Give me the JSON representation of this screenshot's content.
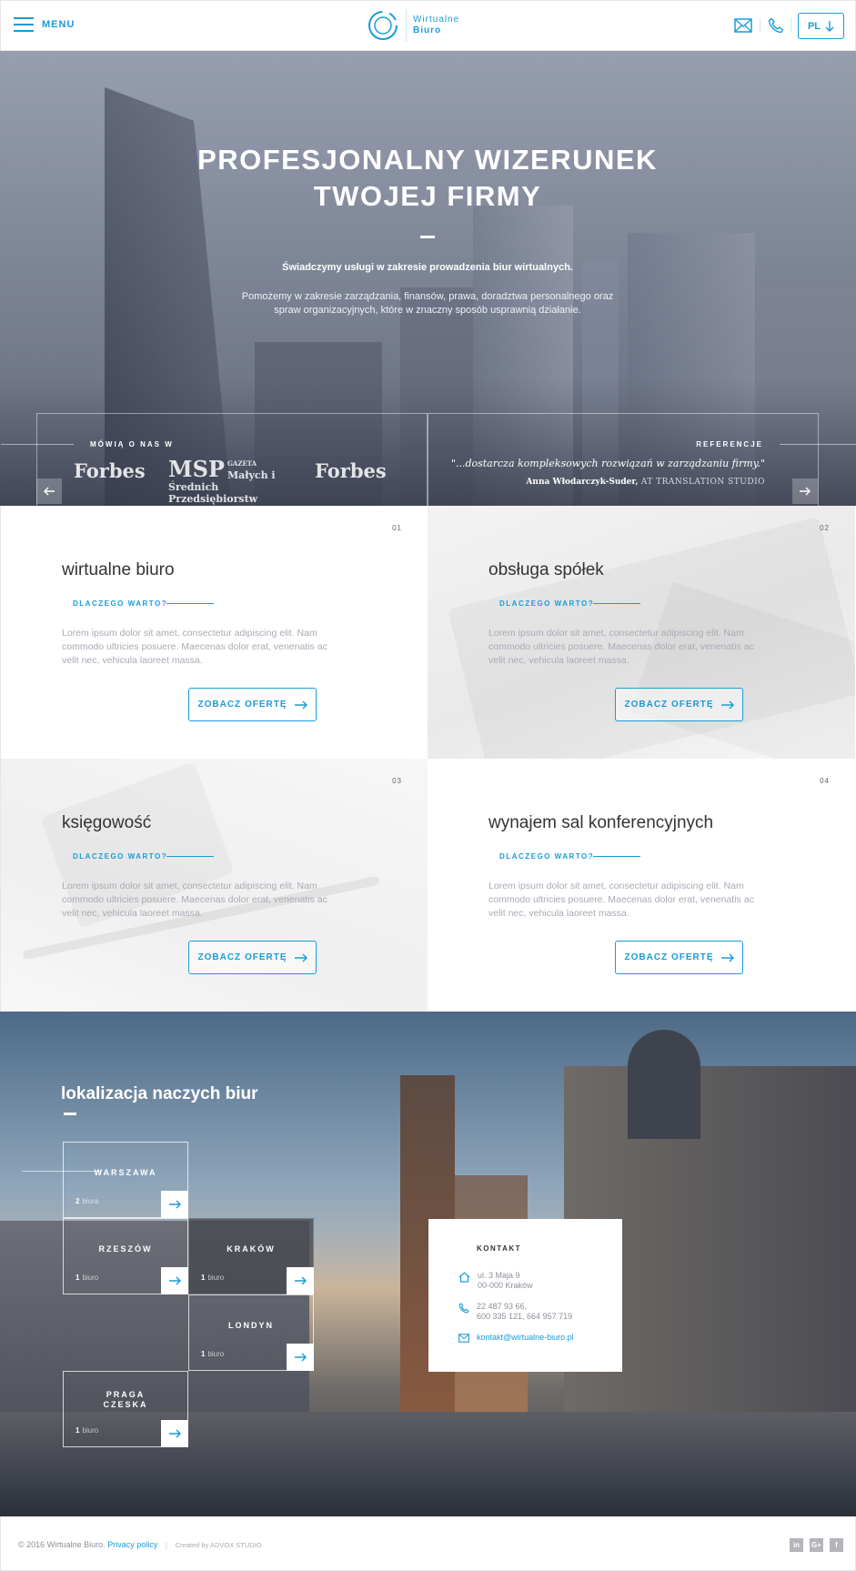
{
  "header": {
    "menu_label": "MENU",
    "logo_line1": "Wirtualne",
    "logo_line2": "Biuro",
    "lang_label": "PL"
  },
  "hero": {
    "title_line1": "PROFESJONALNY WIZERUNEK",
    "title_line2": "TWOJEJ FIRMY",
    "subtitle": "Świadczymy usługi w zakresie prowadzenia biur wirtualnych.",
    "desc_line1": "Pomożemy w zakresie zarządzania, finansów, prawa, doradztwa personalnego oraz",
    "desc_line2": "spraw organizacyjnych, które w znaczny sposób usprawnią działanie.",
    "press_label": "MÓWIĄ O NAS W",
    "press": [
      "Forbes",
      "MSP",
      "GAZETA",
      "Małych i Średnich",
      "Przedsiębiorstw",
      "Forbes"
    ],
    "ref_label": "REFERENCJE",
    "quote": "\"...dostarcza kompleksowych rozwiązań w zarządzaniu firmy.\"",
    "quote_author": "Anna Włodarczyk-Suder,",
    "quote_company": "AT TRANSLATION STUDIO"
  },
  "services": [
    {
      "num": "01",
      "title": "wirtualne biuro",
      "why": "DLACZEGO WARTO?",
      "text": "Lorem ipsum dolor sit amet, consectetur adipiscing elit. Nam commodo ultricies posuere. Maecenas dolor erat, venenatis ac velit nec, vehicula laoreet massa.",
      "button": "ZOBACZ OFERTĘ"
    },
    {
      "num": "02",
      "title": "obsługa spółek",
      "why": "DLACZEGO WARTO?",
      "text": "Lorem ipsum dolor sit amet, consectetur adipiscing elit. Nam commodo ultricies posuere. Maecenas dolor erat, venenatis ac velit nec, vehicula laoreet massa.",
      "button": "ZOBACZ OFERTĘ"
    },
    {
      "num": "03",
      "title": "księgowość",
      "why": "DLACZEGO WARTO?",
      "text": "Lorem ipsum dolor sit amet, consectetur adipiscing elit. Nam commodo ultricies posuere. Maecenas dolor erat, venenatis ac velit nec, vehicula laoreet massa.",
      "button": "ZOBACZ OFERTĘ"
    },
    {
      "num": "04",
      "title": "wynajem sal konferencyjnych",
      "why": "DLACZEGO WARTO?",
      "text": "Lorem ipsum dolor sit amet, consectetur adipiscing elit. Nam commodo ultricies posuere. Maecenas dolor erat, venenatis ac velit nec, vehicula laoreet massa.",
      "button": "ZOBACZ OFERTĘ"
    }
  ],
  "locations": {
    "title": "lokalizacja naczych biur",
    "cities": [
      {
        "name": "WARSZAWA",
        "count": "2",
        "unit": "biura"
      },
      {
        "name": "RZESZÓW",
        "count": "1",
        "unit": "biuro"
      },
      {
        "name": "KRAKÓW",
        "count": "1",
        "unit": "biuro"
      },
      {
        "name": "LONDYN",
        "count": "1",
        "unit": "biuro"
      },
      {
        "name": "PRAGA CZESKA",
        "count": "1",
        "unit": "biuro"
      }
    ],
    "contact": {
      "title": "KONTAKT",
      "address1": "ul. 3 Maja 9",
      "address2": "00-000 Kraków",
      "phone1": "22 487 93 66,",
      "phone2": "600 335 121, 664 957 719",
      "email": "kontakt@wirtualne-biuro.pl"
    }
  },
  "footer": {
    "copyright": "© 2016 Wirtualne Biuro.",
    "privacy": "Privacy policy",
    "separator": "|",
    "credit": "Created by ADVOX STUDIO",
    "social": [
      "in",
      "G+",
      "f"
    ]
  },
  "colors": {
    "accent": "#1a9bd7"
  }
}
